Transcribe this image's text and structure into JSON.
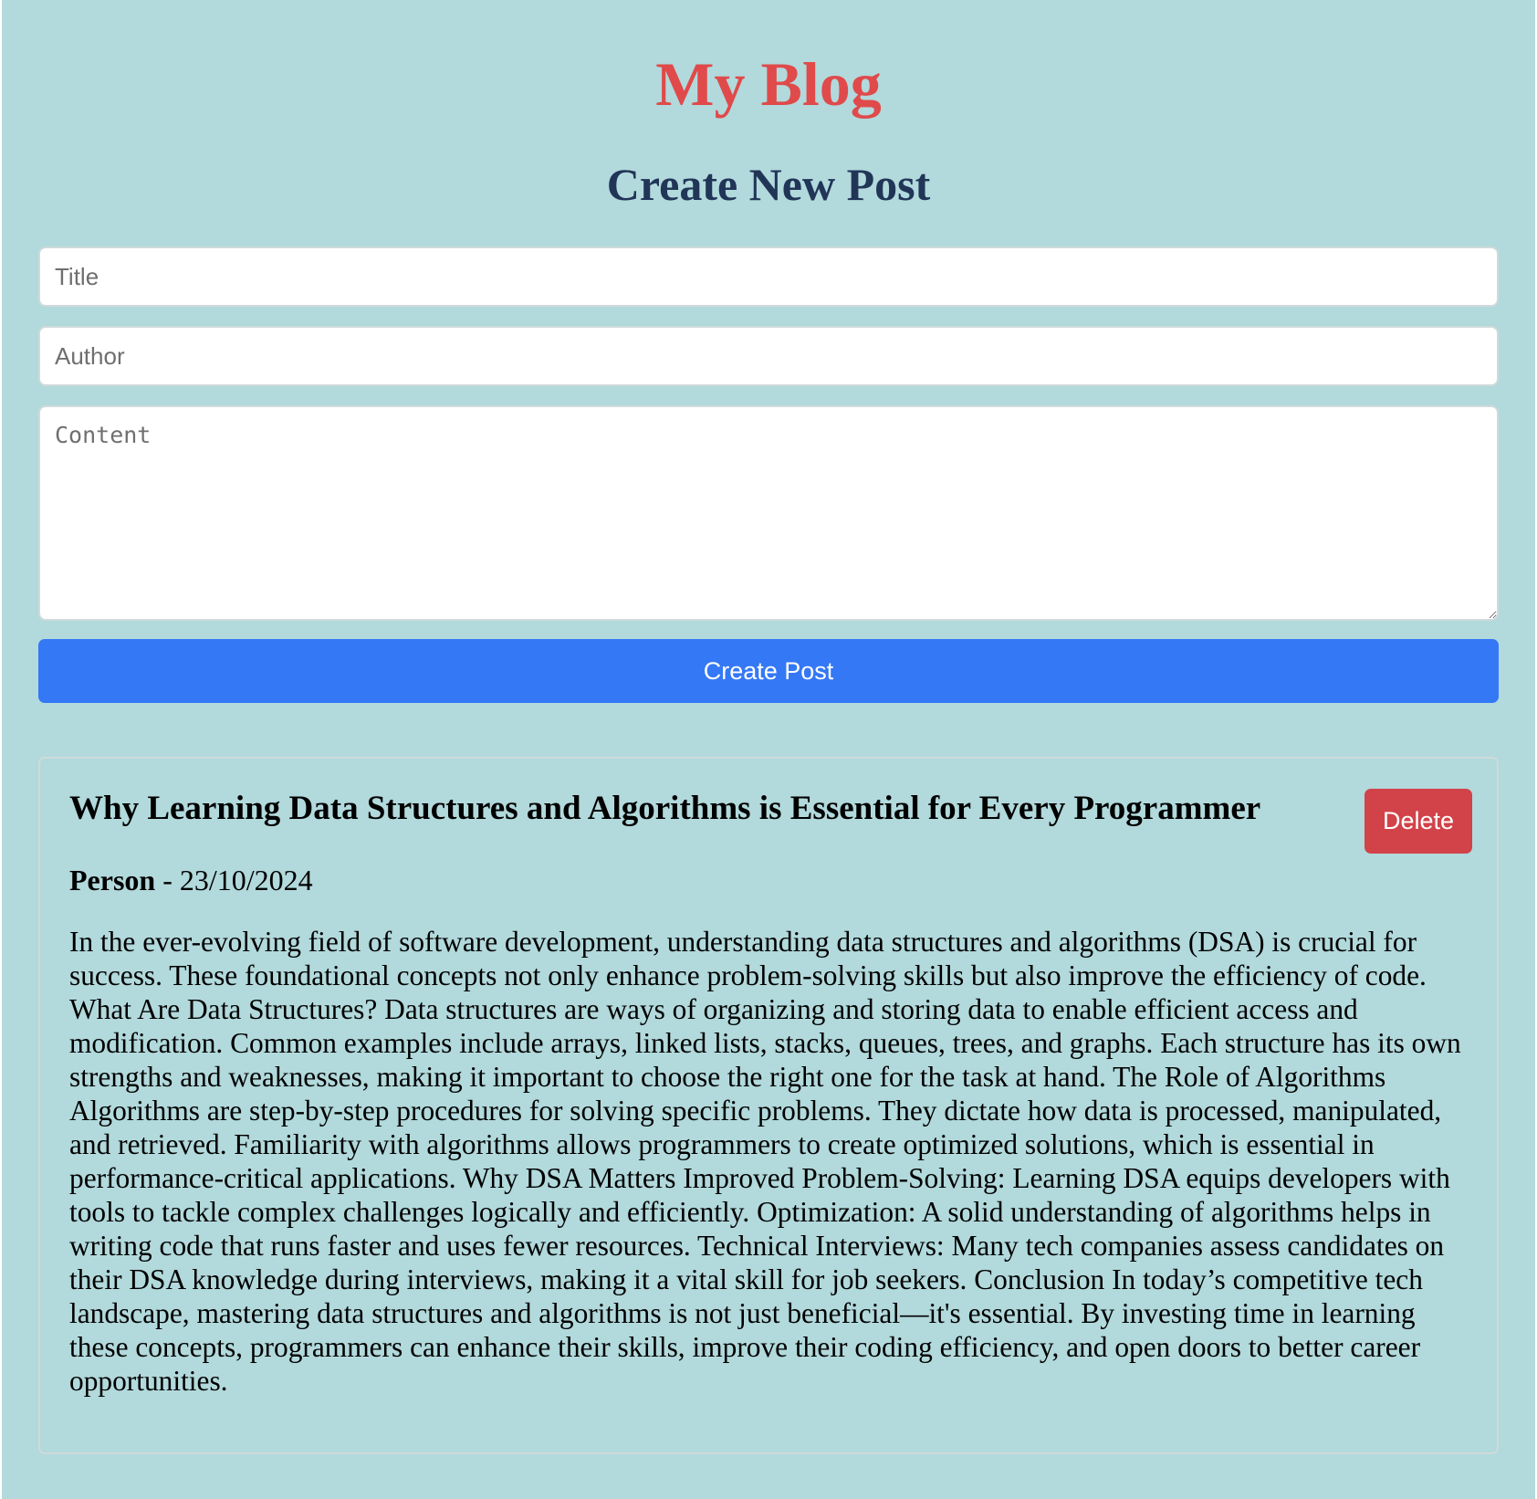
{
  "header": {
    "site_title": "My Blog"
  },
  "form": {
    "heading": "Create New Post",
    "title_placeholder": "Title",
    "author_placeholder": "Author",
    "content_placeholder": "Content",
    "submit_label": "Create Post"
  },
  "posts": [
    {
      "title": "Why Learning Data Structures and Algorithms is Essential for Every Programmer",
      "author": "Person",
      "separator": " - ",
      "date": "23/10/2024",
      "delete_label": "Delete",
      "content": "In the ever-evolving field of software development, understanding data structures and algorithms (DSA) is crucial for success. These foundational concepts not only enhance problem-solving skills but also improve the efficiency of code. What Are Data Structures? Data structures are ways of organizing and storing data to enable efficient access and modification. Common examples include arrays, linked lists, stacks, queues, trees, and graphs. Each structure has its own strengths and weaknesses, making it important to choose the right one for the task at hand. The Role of Algorithms Algorithms are step-by-step procedures for solving specific problems. They dictate how data is processed, manipulated, and retrieved. Familiarity with algorithms allows programmers to create optimized solutions, which is essential in performance-critical applications. Why DSA Matters Improved Problem-Solving: Learning DSA equips developers with tools to tackle complex challenges logically and efficiently. Optimization: A solid understanding of algorithms helps in writing code that runs faster and uses fewer resources. Technical Interviews: Many tech companies assess candidates on their DSA knowledge during interviews, making it a vital skill for job seekers. Conclusion In today’s competitive tech landscape, mastering data structures and algorithms is not just beneficial—it's essential. By investing time in learning these concepts, programmers can enhance their skills, improve their coding efficiency, and open doors to better career opportunities."
    }
  ],
  "colors": {
    "background": "#b2d9dc",
    "site_title": "#e04a4a",
    "form_heading": "#213557",
    "primary_button": "#3478f6",
    "delete_button": "#d24249"
  }
}
